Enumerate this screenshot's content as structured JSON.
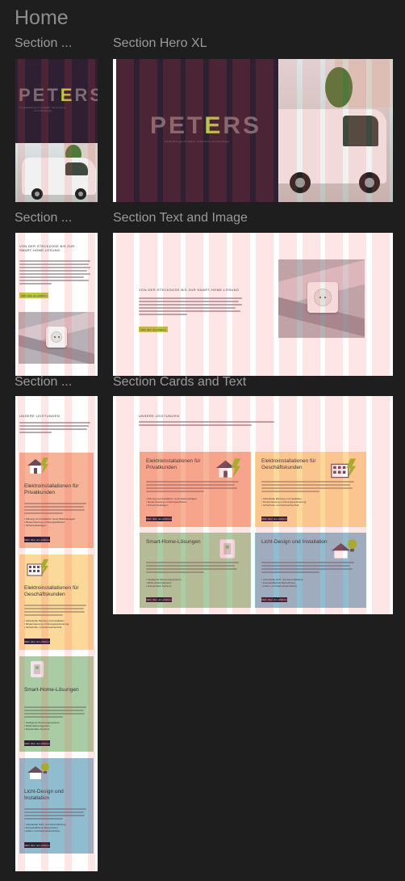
{
  "page": {
    "title": "Home"
  },
  "labels": {
    "m1": "Section ...",
    "hero": "Section Hero XL",
    "m2": "Section ...",
    "textimg": "Section Text and Image",
    "m3": "Section ...",
    "cards": "Section Cards and Text"
  },
  "hero": {
    "logo_a": "PET",
    "logo_e": "E",
    "logo_b": "RS",
    "tagline": "Komplettlösungen für Elektro, Smart-Home und Licht-Design"
  },
  "text_image": {
    "heading": "VON DER STECKDOSE BIS ZUR SMART-HOME-LÖSUNG",
    "heading_desktop": "VON DER STECKDOSE BIS ZUR SMART-HOME-LÖSUNG",
    "button": "Mehr über uns erfahren"
  },
  "cards_section": {
    "heading": "UNSERE LEISTUNGEN",
    "cards": [
      {
        "title": "Elektroinstallationen für Privatkunden",
        "bullets": [
          "Planung und Installation neuer Elektroanlagen",
          "Modernisierung und Energieeffizienz",
          "Sicherheitsanlagen"
        ],
        "button": "Mehr über uns erfahren",
        "color": "#f6b397",
        "icon": "house-icon"
      },
      {
        "title": "Elektroinstallationen für Geschäftskunden",
        "bullets": [
          "Individuelle Planung und Installation",
          "Modernisierung und Energieoptimierung",
          "Sicherheits- und Netzwerktechnik"
        ],
        "button": "Mehr über uns erfahren",
        "color": "#fbd99a",
        "icon": "building-icon"
      },
      {
        "title": "Smart-Home-Lösungen",
        "bullets": [
          "Intelligente Steuerungssysteme",
          "Multimedia-Integration",
          "Erweiterbare Systeme"
        ],
        "button": "Mehr über uns erfahren",
        "color": "#a9cca4",
        "icon": "smart-switch-icon"
      },
      {
        "title": "Licht-Design und Installation",
        "bullets": [
          "Individuelle Licht- und Akzentplanung",
          "Energieeffiziente Beleuchtung",
          "Außen- und Gartenbeleuchtung"
        ],
        "button": "Mehr über uns erfahren",
        "color": "#90bcd0",
        "icon": "lightbulb-house-icon"
      }
    ]
  }
}
